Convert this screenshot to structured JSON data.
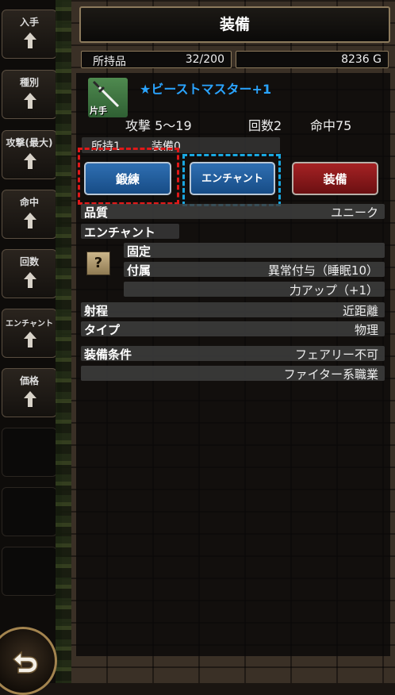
{
  "sidebar": {
    "sort_buttons": [
      {
        "label": "入手"
      },
      {
        "label": "種別"
      },
      {
        "label": "攻撃(最大)"
      },
      {
        "label": "命中"
      },
      {
        "label": "回数"
      },
      {
        "label": "エンチャント"
      },
      {
        "label": "価格"
      }
    ],
    "arrow_icon": "up-arrow-icon",
    "back_icon": "return-arrow-icon"
  },
  "header": {
    "title": "装備",
    "inventory_label": "所持品",
    "inventory_count": "32/200",
    "gold": "8236 G"
  },
  "item": {
    "icon": "sword-icon",
    "hand_type": "片手",
    "name": "★ビーストマスター+1",
    "attack": "攻撃 5～19",
    "hits": "回数2",
    "accuracy": "命中75",
    "owned": "所持1",
    "equipped": "装備0"
  },
  "actions": {
    "forge": "鍛練",
    "enchant": "エンチャント",
    "equip": "装備"
  },
  "details": {
    "quality_label": "品質",
    "quality_value": "ユニーク",
    "enchant_label": "エンチャント",
    "unknown_slot": "?",
    "fixed_label": "固定",
    "attached_label": "付属",
    "attached_values": [
      "異常付与（睡眠10）",
      "力アップ（+1）"
    ],
    "range_label": "射程",
    "range_value": "近距離",
    "type_label": "タイプ",
    "type_value": "物理",
    "requirement_label": "装備条件",
    "requirements": [
      "フェアリー不可",
      "ファイター系職業"
    ]
  },
  "colors": {
    "item_name": "#2aa4ff",
    "forge_button": "#1f5d9e",
    "equip_button": "#8e1719",
    "highlight_red": "#e01818",
    "highlight_blue": "#19a7e0"
  }
}
